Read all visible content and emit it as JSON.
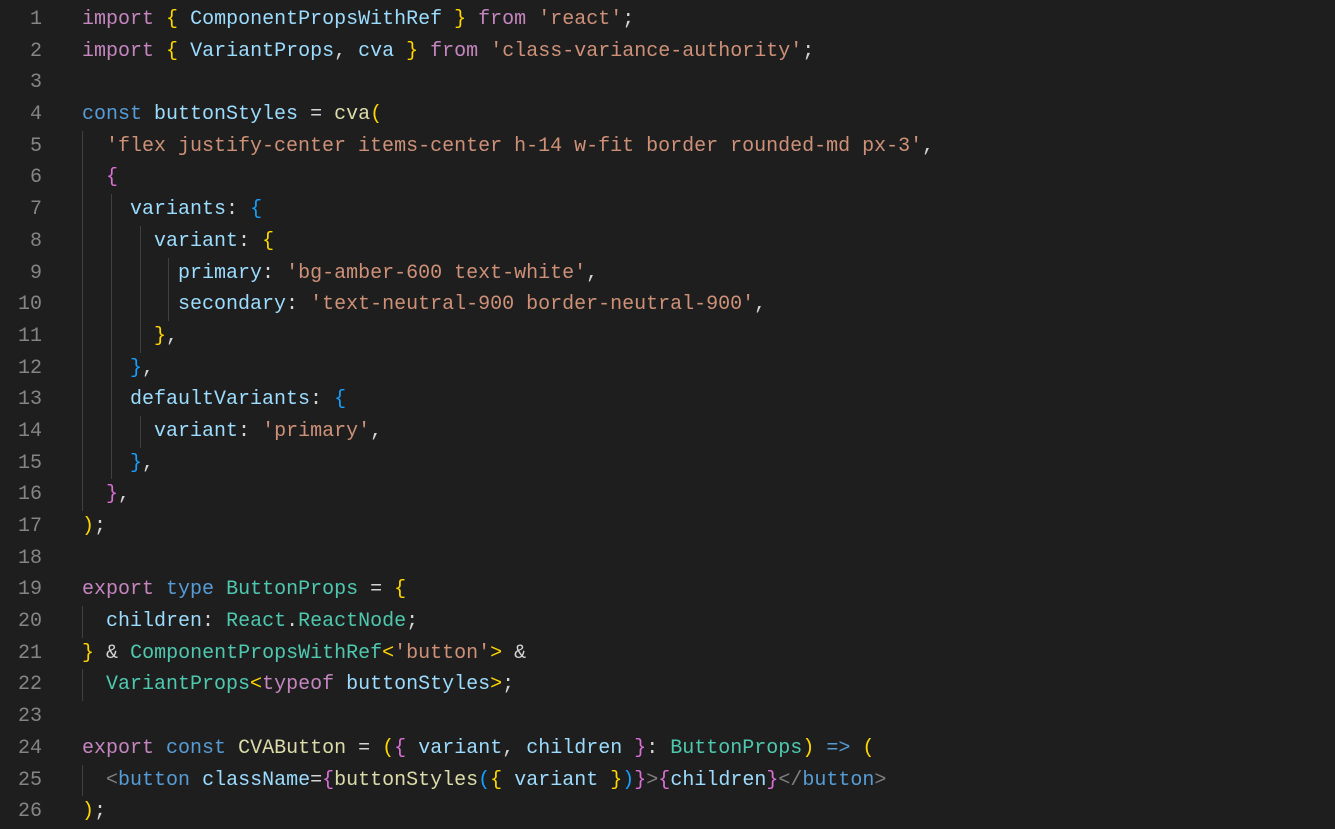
{
  "lineCount": 26,
  "tokens": {
    "l1": [
      {
        "cls": "tk-kw",
        "t": "import"
      },
      {
        "cls": "tk-punc",
        "t": " "
      },
      {
        "cls": "tk-brace1",
        "t": "{"
      },
      {
        "cls": "tk-punc",
        "t": " "
      },
      {
        "cls": "tk-var",
        "t": "ComponentPropsWithRef"
      },
      {
        "cls": "tk-punc",
        "t": " "
      },
      {
        "cls": "tk-brace1",
        "t": "}"
      },
      {
        "cls": "tk-punc",
        "t": " "
      },
      {
        "cls": "tk-kw",
        "t": "from"
      },
      {
        "cls": "tk-punc",
        "t": " "
      },
      {
        "cls": "tk-str",
        "t": "'react'"
      },
      {
        "cls": "tk-punc",
        "t": ";"
      }
    ],
    "l2": [
      {
        "cls": "tk-kw",
        "t": "import"
      },
      {
        "cls": "tk-punc",
        "t": " "
      },
      {
        "cls": "tk-brace1",
        "t": "{"
      },
      {
        "cls": "tk-punc",
        "t": " "
      },
      {
        "cls": "tk-var",
        "t": "VariantProps"
      },
      {
        "cls": "tk-punc",
        "t": ", "
      },
      {
        "cls": "tk-var",
        "t": "cva"
      },
      {
        "cls": "tk-punc",
        "t": " "
      },
      {
        "cls": "tk-brace1",
        "t": "}"
      },
      {
        "cls": "tk-punc",
        "t": " "
      },
      {
        "cls": "tk-kw",
        "t": "from"
      },
      {
        "cls": "tk-punc",
        "t": " "
      },
      {
        "cls": "tk-str",
        "t": "'class-variance-authority'"
      },
      {
        "cls": "tk-punc",
        "t": ";"
      }
    ],
    "l3": [],
    "l4": [
      {
        "cls": "tk-blue",
        "t": "const"
      },
      {
        "cls": "tk-punc",
        "t": " "
      },
      {
        "cls": "tk-var",
        "t": "buttonStyles"
      },
      {
        "cls": "tk-punc",
        "t": " "
      },
      {
        "cls": "tk-punc",
        "t": "="
      },
      {
        "cls": "tk-punc",
        "t": " "
      },
      {
        "cls": "tk-fn",
        "t": "cva"
      },
      {
        "cls": "tk-brace1",
        "t": "("
      }
    ],
    "l5": [
      {
        "cls": "tk-punc",
        "t": "  "
      },
      {
        "cls": "tk-str",
        "t": "'flex justify-center items-center h-14 w-fit border rounded-md px-3'"
      },
      {
        "cls": "tk-punc",
        "t": ","
      }
    ],
    "l6": [
      {
        "cls": "tk-punc",
        "t": "  "
      },
      {
        "cls": "tk-brace2",
        "t": "{"
      }
    ],
    "l7": [
      {
        "cls": "tk-punc",
        "t": "    "
      },
      {
        "cls": "tk-var",
        "t": "variants"
      },
      {
        "cls": "tk-punc",
        "t": ":"
      },
      {
        "cls": "tk-punc",
        "t": " "
      },
      {
        "cls": "tk-brace3",
        "t": "{"
      }
    ],
    "l8": [
      {
        "cls": "tk-punc",
        "t": "      "
      },
      {
        "cls": "tk-var",
        "t": "variant"
      },
      {
        "cls": "tk-punc",
        "t": ":"
      },
      {
        "cls": "tk-punc",
        "t": " "
      },
      {
        "cls": "tk-brace1",
        "t": "{"
      }
    ],
    "l9": [
      {
        "cls": "tk-punc",
        "t": "        "
      },
      {
        "cls": "tk-var",
        "t": "primary"
      },
      {
        "cls": "tk-punc",
        "t": ":"
      },
      {
        "cls": "tk-punc",
        "t": " "
      },
      {
        "cls": "tk-str",
        "t": "'bg-amber-600 text-white'"
      },
      {
        "cls": "tk-punc",
        "t": ","
      }
    ],
    "l10": [
      {
        "cls": "tk-punc",
        "t": "        "
      },
      {
        "cls": "tk-var",
        "t": "secondary"
      },
      {
        "cls": "tk-punc",
        "t": ":"
      },
      {
        "cls": "tk-punc",
        "t": " "
      },
      {
        "cls": "tk-str",
        "t": "'text-neutral-900 border-neutral-900'"
      },
      {
        "cls": "tk-punc",
        "t": ","
      }
    ],
    "l11": [
      {
        "cls": "tk-punc",
        "t": "      "
      },
      {
        "cls": "tk-brace1",
        "t": "}"
      },
      {
        "cls": "tk-punc",
        "t": ","
      }
    ],
    "l12": [
      {
        "cls": "tk-punc",
        "t": "    "
      },
      {
        "cls": "tk-brace3",
        "t": "}"
      },
      {
        "cls": "tk-punc",
        "t": ","
      }
    ],
    "l13": [
      {
        "cls": "tk-punc",
        "t": "    "
      },
      {
        "cls": "tk-var",
        "t": "defaultVariants"
      },
      {
        "cls": "tk-punc",
        "t": ":"
      },
      {
        "cls": "tk-punc",
        "t": " "
      },
      {
        "cls": "tk-brace3",
        "t": "{"
      }
    ],
    "l14": [
      {
        "cls": "tk-punc",
        "t": "      "
      },
      {
        "cls": "tk-var",
        "t": "variant"
      },
      {
        "cls": "tk-punc",
        "t": ":"
      },
      {
        "cls": "tk-punc",
        "t": " "
      },
      {
        "cls": "tk-str",
        "t": "'primary'"
      },
      {
        "cls": "tk-punc",
        "t": ","
      }
    ],
    "l15": [
      {
        "cls": "tk-punc",
        "t": "    "
      },
      {
        "cls": "tk-brace3",
        "t": "}"
      },
      {
        "cls": "tk-punc",
        "t": ","
      }
    ],
    "l16": [
      {
        "cls": "tk-punc",
        "t": "  "
      },
      {
        "cls": "tk-brace2",
        "t": "}"
      },
      {
        "cls": "tk-punc",
        "t": ","
      }
    ],
    "l17": [
      {
        "cls": "tk-brace1",
        "t": ")"
      },
      {
        "cls": "tk-punc",
        "t": ";"
      }
    ],
    "l18": [],
    "l19": [
      {
        "cls": "tk-kw",
        "t": "export"
      },
      {
        "cls": "tk-punc",
        "t": " "
      },
      {
        "cls": "tk-blue",
        "t": "type"
      },
      {
        "cls": "tk-punc",
        "t": " "
      },
      {
        "cls": "tk-type",
        "t": "ButtonProps"
      },
      {
        "cls": "tk-punc",
        "t": " "
      },
      {
        "cls": "tk-punc",
        "t": "="
      },
      {
        "cls": "tk-punc",
        "t": " "
      },
      {
        "cls": "tk-brace1",
        "t": "{"
      }
    ],
    "l20": [
      {
        "cls": "tk-punc",
        "t": "  "
      },
      {
        "cls": "tk-var",
        "t": "children"
      },
      {
        "cls": "tk-punc",
        "t": ":"
      },
      {
        "cls": "tk-punc",
        "t": " "
      },
      {
        "cls": "tk-type",
        "t": "React"
      },
      {
        "cls": "tk-punc",
        "t": "."
      },
      {
        "cls": "tk-type",
        "t": "ReactNode"
      },
      {
        "cls": "tk-punc",
        "t": ";"
      }
    ],
    "l21": [
      {
        "cls": "tk-brace1",
        "t": "}"
      },
      {
        "cls": "tk-punc",
        "t": " "
      },
      {
        "cls": "tk-punc",
        "t": "&"
      },
      {
        "cls": "tk-punc",
        "t": " "
      },
      {
        "cls": "tk-type",
        "t": "ComponentPropsWithRef"
      },
      {
        "cls": "tk-brace1",
        "t": "<"
      },
      {
        "cls": "tk-str",
        "t": "'button'"
      },
      {
        "cls": "tk-brace1",
        "t": ">"
      },
      {
        "cls": "tk-punc",
        "t": " "
      },
      {
        "cls": "tk-punc",
        "t": "&"
      }
    ],
    "l22": [
      {
        "cls": "tk-punc",
        "t": "  "
      },
      {
        "cls": "tk-type",
        "t": "VariantProps"
      },
      {
        "cls": "tk-brace1",
        "t": "<"
      },
      {
        "cls": "tk-kw",
        "t": "typeof"
      },
      {
        "cls": "tk-punc",
        "t": " "
      },
      {
        "cls": "tk-var",
        "t": "buttonStyles"
      },
      {
        "cls": "tk-brace1",
        "t": ">"
      },
      {
        "cls": "tk-punc",
        "t": ";"
      }
    ],
    "l23": [],
    "l24": [
      {
        "cls": "tk-kw",
        "t": "export"
      },
      {
        "cls": "tk-punc",
        "t": " "
      },
      {
        "cls": "tk-blue",
        "t": "const"
      },
      {
        "cls": "tk-punc",
        "t": " "
      },
      {
        "cls": "tk-fn",
        "t": "CVAButton"
      },
      {
        "cls": "tk-punc",
        "t": " "
      },
      {
        "cls": "tk-punc",
        "t": "="
      },
      {
        "cls": "tk-punc",
        "t": " "
      },
      {
        "cls": "tk-brace1",
        "t": "("
      },
      {
        "cls": "tk-brace2",
        "t": "{"
      },
      {
        "cls": "tk-punc",
        "t": " "
      },
      {
        "cls": "tk-var",
        "t": "variant"
      },
      {
        "cls": "tk-punc",
        "t": ", "
      },
      {
        "cls": "tk-var",
        "t": "children"
      },
      {
        "cls": "tk-punc",
        "t": " "
      },
      {
        "cls": "tk-brace2",
        "t": "}"
      },
      {
        "cls": "tk-punc",
        "t": ": "
      },
      {
        "cls": "tk-type",
        "t": "ButtonProps"
      },
      {
        "cls": "tk-brace1",
        "t": ")"
      },
      {
        "cls": "tk-punc",
        "t": " "
      },
      {
        "cls": "tk-blue",
        "t": "=>"
      },
      {
        "cls": "tk-punc",
        "t": " "
      },
      {
        "cls": "tk-brace1",
        "t": "("
      }
    ],
    "l25": [
      {
        "cls": "tk-punc",
        "t": "  "
      },
      {
        "cls": "tk-tagp",
        "t": "<"
      },
      {
        "cls": "tk-tag",
        "t": "button"
      },
      {
        "cls": "tk-punc",
        "t": " "
      },
      {
        "cls": "tk-var",
        "t": "className"
      },
      {
        "cls": "tk-punc",
        "t": "="
      },
      {
        "cls": "tk-brace2",
        "t": "{"
      },
      {
        "cls": "tk-fn",
        "t": "buttonStyles"
      },
      {
        "cls": "tk-brace3",
        "t": "("
      },
      {
        "cls": "tk-brace1",
        "t": "{"
      },
      {
        "cls": "tk-punc",
        "t": " "
      },
      {
        "cls": "tk-var",
        "t": "variant"
      },
      {
        "cls": "tk-punc",
        "t": " "
      },
      {
        "cls": "tk-brace1",
        "t": "}"
      },
      {
        "cls": "tk-brace3",
        "t": ")"
      },
      {
        "cls": "tk-brace2",
        "t": "}"
      },
      {
        "cls": "tk-tagp",
        "t": ">"
      },
      {
        "cls": "tk-brace2",
        "t": "{"
      },
      {
        "cls": "tk-var",
        "t": "children"
      },
      {
        "cls": "tk-brace2",
        "t": "}"
      },
      {
        "cls": "tk-tagp",
        "t": "</"
      },
      {
        "cls": "tk-tag",
        "t": "button"
      },
      {
        "cls": "tk-tagp",
        "t": ">"
      }
    ],
    "l26": [
      {
        "cls": "tk-brace1",
        "t": ")"
      },
      {
        "cls": "tk-punc",
        "t": ";"
      }
    ]
  },
  "indentGuides": {
    "5": [
      0
    ],
    "6": [
      0
    ],
    "7": [
      0,
      1
    ],
    "8": [
      0,
      1,
      2
    ],
    "9": [
      0,
      1,
      2,
      3
    ],
    "10": [
      0,
      1,
      2,
      3
    ],
    "11": [
      0,
      1,
      2
    ],
    "12": [
      0,
      1
    ],
    "13": [
      0,
      1
    ],
    "14": [
      0,
      1,
      2
    ],
    "15": [
      0,
      1
    ],
    "16": [
      0
    ],
    "20": [
      0
    ],
    "22": [
      0
    ],
    "25": [
      0
    ]
  },
  "indentWidthCh": 2.4
}
